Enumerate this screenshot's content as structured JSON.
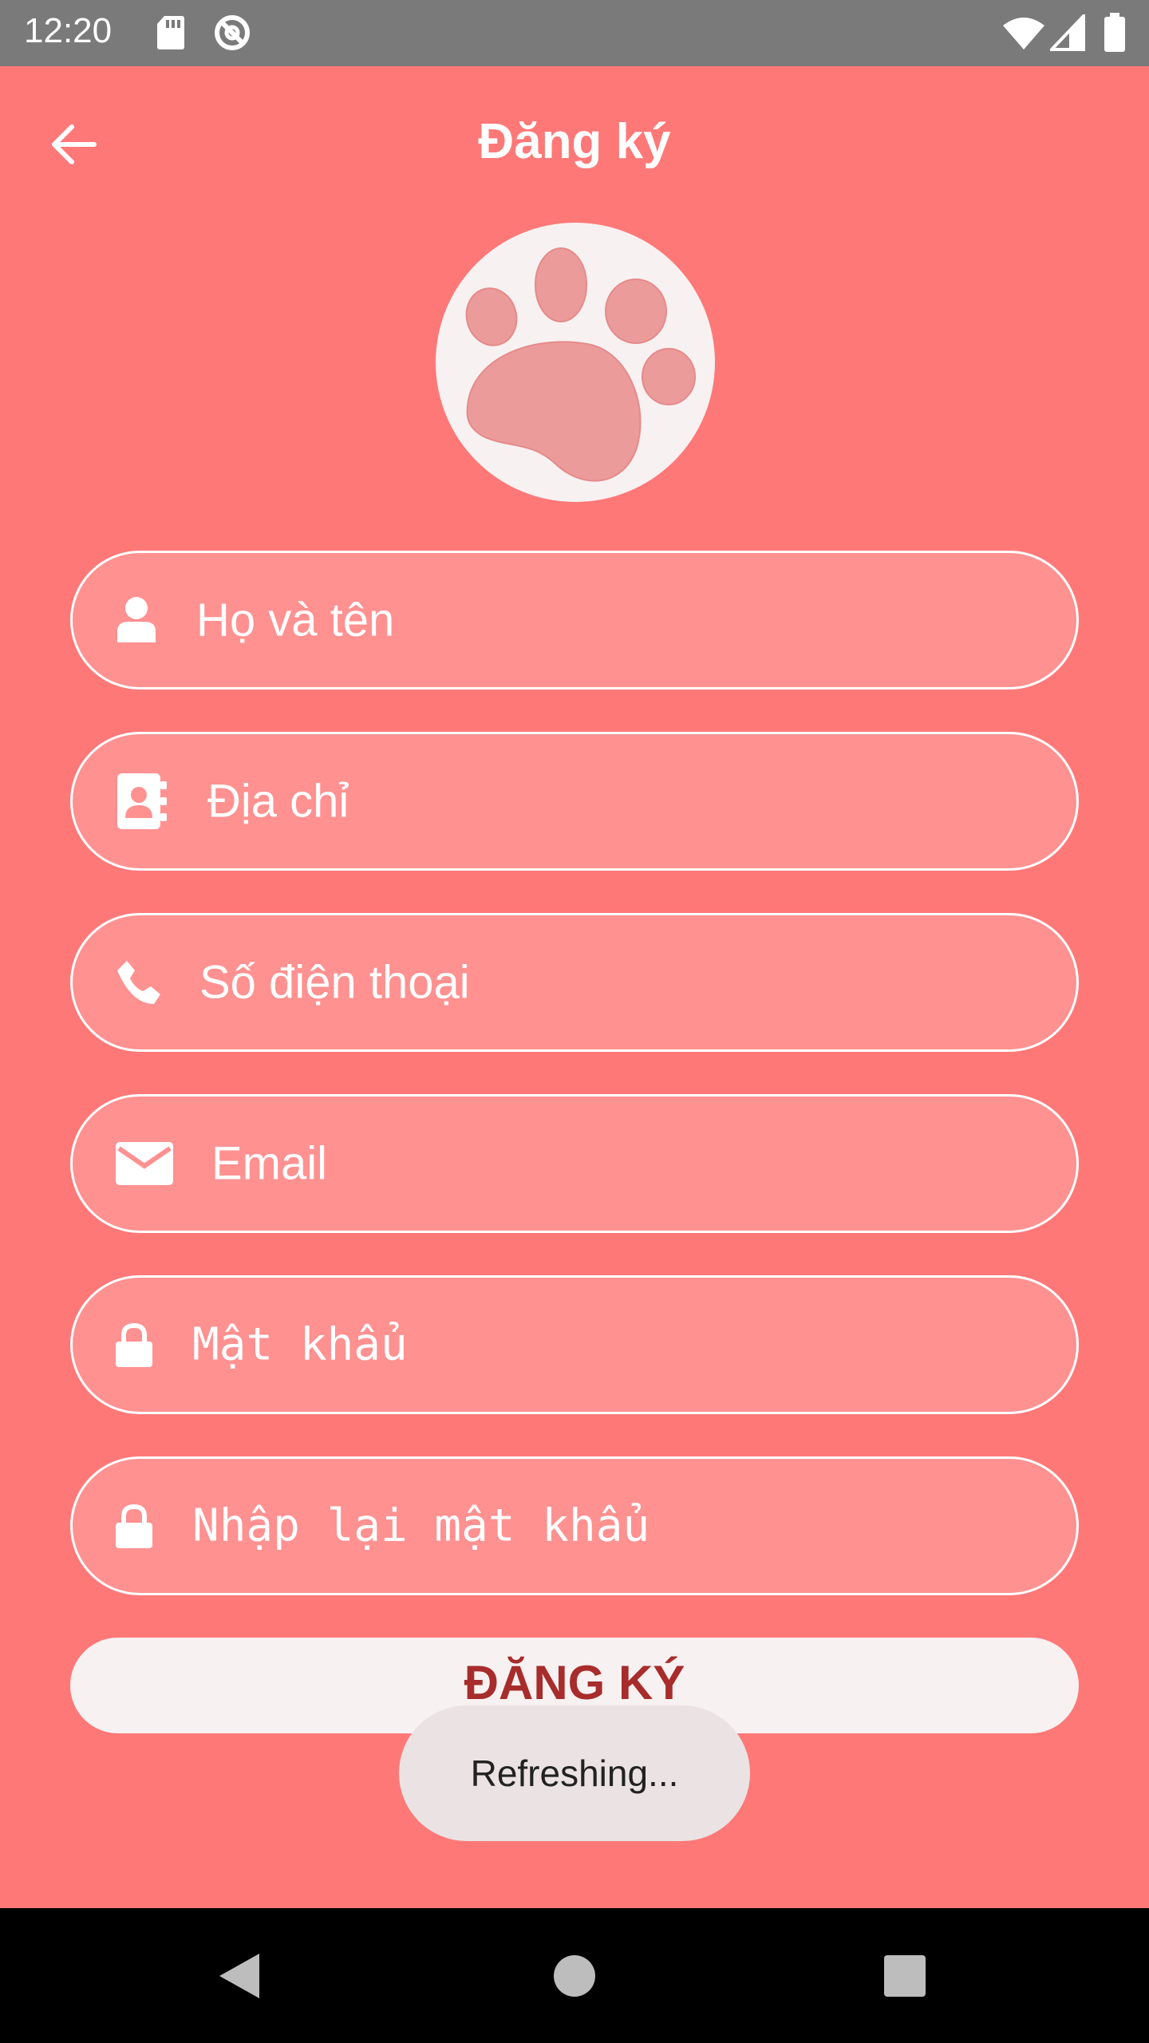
{
  "status_bar": {
    "time": "12:20",
    "icons": [
      "sd-card-icon",
      "data-saver-icon",
      "wifi-icon",
      "signal-icon",
      "battery-icon"
    ]
  },
  "header": {
    "title": "Đăng ký",
    "back_icon": "arrow-left-icon"
  },
  "logo": {
    "icon": "paw-icon",
    "colors": {
      "circle": "#f7f1f1",
      "paw": "#ec9b9b"
    }
  },
  "form": {
    "full_name_placeholder": "Họ và tên",
    "address_placeholder": "Địa chỉ",
    "phone_placeholder": "Số điện thoại",
    "email_placeholder": "Email",
    "password_placeholder": "Mật khẩu",
    "confirm_password_placeholder": "Nhập lại mật khẩu",
    "submit_label": "ĐĂNG KÝ"
  },
  "toast": {
    "message": "Refreshing..."
  },
  "nav_bar": {
    "icons": [
      "back-triangle-icon",
      "home-circle-icon",
      "recents-square-icon"
    ]
  },
  "colors": {
    "background": "#ff7878",
    "field_fill": "#ff9191",
    "field_border": "#ffffff",
    "button_fill": "#f7f1f1",
    "button_text": "#a82c2c",
    "status_bar": "#7a7a7a",
    "nav_bar": "#000000"
  }
}
